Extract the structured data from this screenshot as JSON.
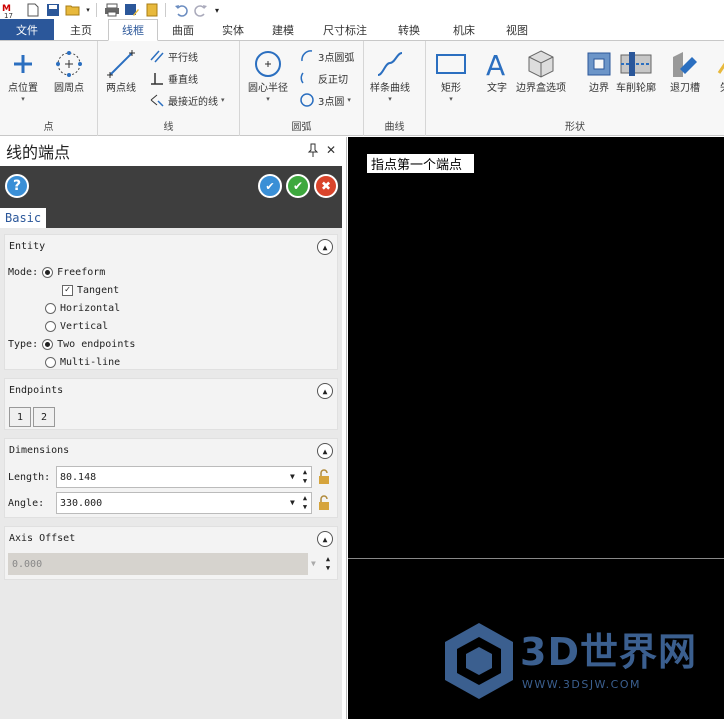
{
  "app": {
    "logo_text": "17"
  },
  "ribbon_tabs": [
    {
      "label": "文件"
    },
    {
      "label": "主页"
    },
    {
      "label": "线框"
    },
    {
      "label": "曲面"
    },
    {
      "label": "实体"
    },
    {
      "label": "建模"
    },
    {
      "label": "尺寸标注"
    },
    {
      "label": "转换"
    },
    {
      "label": "机床"
    },
    {
      "label": "视图"
    }
  ],
  "ribbon": {
    "groups": {
      "point": "点",
      "line": "线",
      "arc": "圆弧",
      "curve": "曲线",
      "shape": "形状"
    },
    "buttons": {
      "point_position": "点位置",
      "circle_points": "圆周点",
      "two_point_line": "两点线",
      "parallel_line": "平行线",
      "perpendicular_line": "垂直线",
      "closest_line": "最接近的线",
      "circle_center_radius": "圆心半径",
      "three_point_arc": "3点圆弧",
      "reverse_tangent": "反正切",
      "three_point_circle": "3点圆",
      "spline_curve": "样条曲线",
      "rectangle": "矩形",
      "text": "文字",
      "bounding_box": "边界盒选项",
      "boundary": "边界",
      "turn_profile": "车削轮廓",
      "groove": "退刀槽",
      "arrow": "矢"
    }
  },
  "panel": {
    "title": "线的端点",
    "pin_glyph": "↑",
    "close_glyph": "✕",
    "basic_tab": "Basic",
    "sections": {
      "entity": {
        "title": "Entity",
        "mode_label": "Mode:",
        "freeform": "Freeform",
        "tangent": "Tangent",
        "horizontal": "Horizontal",
        "vertical": "Vertical",
        "type_label": "Type:",
        "two_endpoints": "Two endpoints",
        "multi_line": "Multi-line"
      },
      "endpoints": {
        "title": "Endpoints",
        "btn1": "1",
        "btn2": "2"
      },
      "dimensions": {
        "title": "Dimensions",
        "length_label": "Length:",
        "length_value": "80.148",
        "angle_label": "Angle:",
        "angle_value": "330.000"
      },
      "axis_offset": {
        "title": "Axis Offset",
        "value": "0.000"
      }
    }
  },
  "viewport": {
    "prompt": "指点第一个端点"
  },
  "watermark": {
    "text": "3D世界网",
    "sub": "WWW.3DSJW.COM"
  },
  "colors": {
    "accent": "#2b579a",
    "toolbar_dark": "#3e3e3e",
    "help_blue": "#3a8fd6",
    "ok_green": "#3ea83e",
    "cancel_red": "#d9442b"
  }
}
